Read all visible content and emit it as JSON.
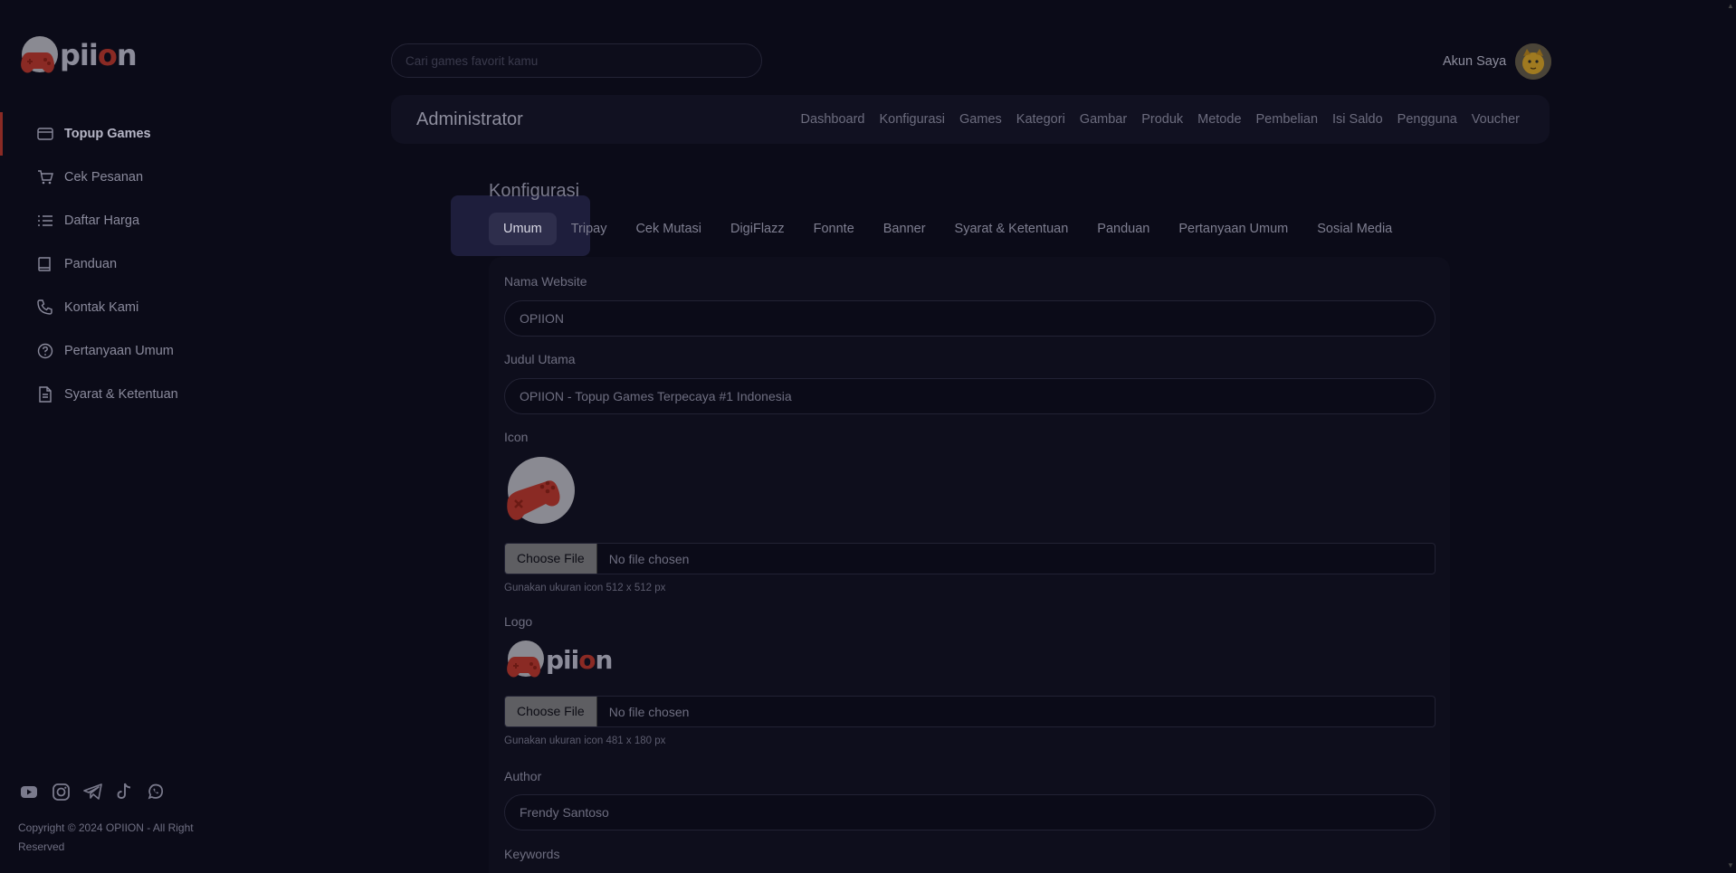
{
  "brand": {
    "logo_text_a": "pii",
    "logo_text_o": "o",
    "logo_text_b": "n"
  },
  "sidebar": {
    "items": [
      {
        "label": "Topup Games",
        "icon": "card-icon"
      },
      {
        "label": "Cek Pesanan",
        "icon": "cart-icon"
      },
      {
        "label": "Daftar Harga",
        "icon": "list-icon"
      },
      {
        "label": "Panduan",
        "icon": "book-icon"
      },
      {
        "label": "Kontak Kami",
        "icon": "phone-icon"
      },
      {
        "label": "Pertanyaan Umum",
        "icon": "question-icon"
      },
      {
        "label": "Syarat & Ketentuan",
        "icon": "document-icon"
      }
    ],
    "socials": [
      "youtube-icon",
      "instagram-icon",
      "telegram-icon",
      "tiktok-icon",
      "whatsapp-icon"
    ],
    "copyright": "Copyright © 2024 OPIION - All Right Reserved"
  },
  "header": {
    "search_placeholder": "Cari games favorit kamu",
    "account_label": "Akun Saya"
  },
  "admin": {
    "title": "Administrator",
    "menu": [
      "Dashboard",
      "Konfigurasi",
      "Games",
      "Kategori",
      "Gambar",
      "Produk",
      "Metode",
      "Pembelian",
      "Isi Saldo",
      "Pengguna",
      "Voucher"
    ]
  },
  "config": {
    "title": "Konfigurasi",
    "tabs": [
      "Umum",
      "Tripay",
      "Cek Mutasi",
      "DigiFlazz",
      "Fonnte",
      "Banner",
      "Syarat & Ketentuan",
      "Panduan",
      "Pertanyaan Umum",
      "Sosial Media"
    ],
    "active_tab": "Umum",
    "fields": {
      "nama_website_label": "Nama Website",
      "nama_website_value": "OPIION",
      "judul_utama_label": "Judul Utama",
      "judul_utama_value": "OPIION - Topup Games Terpecaya #1 Indonesia",
      "icon_label": "Icon",
      "icon_choose": "Choose File",
      "icon_none": "No file chosen",
      "icon_hint": "Gunakan ukuran icon 512 x 512 px",
      "logo_label": "Logo",
      "logo_choose": "Choose File",
      "logo_none": "No file chosen",
      "logo_hint": "Gunakan ukuran icon 481 x 180 px",
      "author_label": "Author",
      "author_value": "Frendy Santoso",
      "keywords_label": "Keywords"
    }
  },
  "colors": {
    "accent": "#8a2a24",
    "background": "#0b0b18",
    "panel": "#111121",
    "active_tab": "#2e2e4c"
  }
}
